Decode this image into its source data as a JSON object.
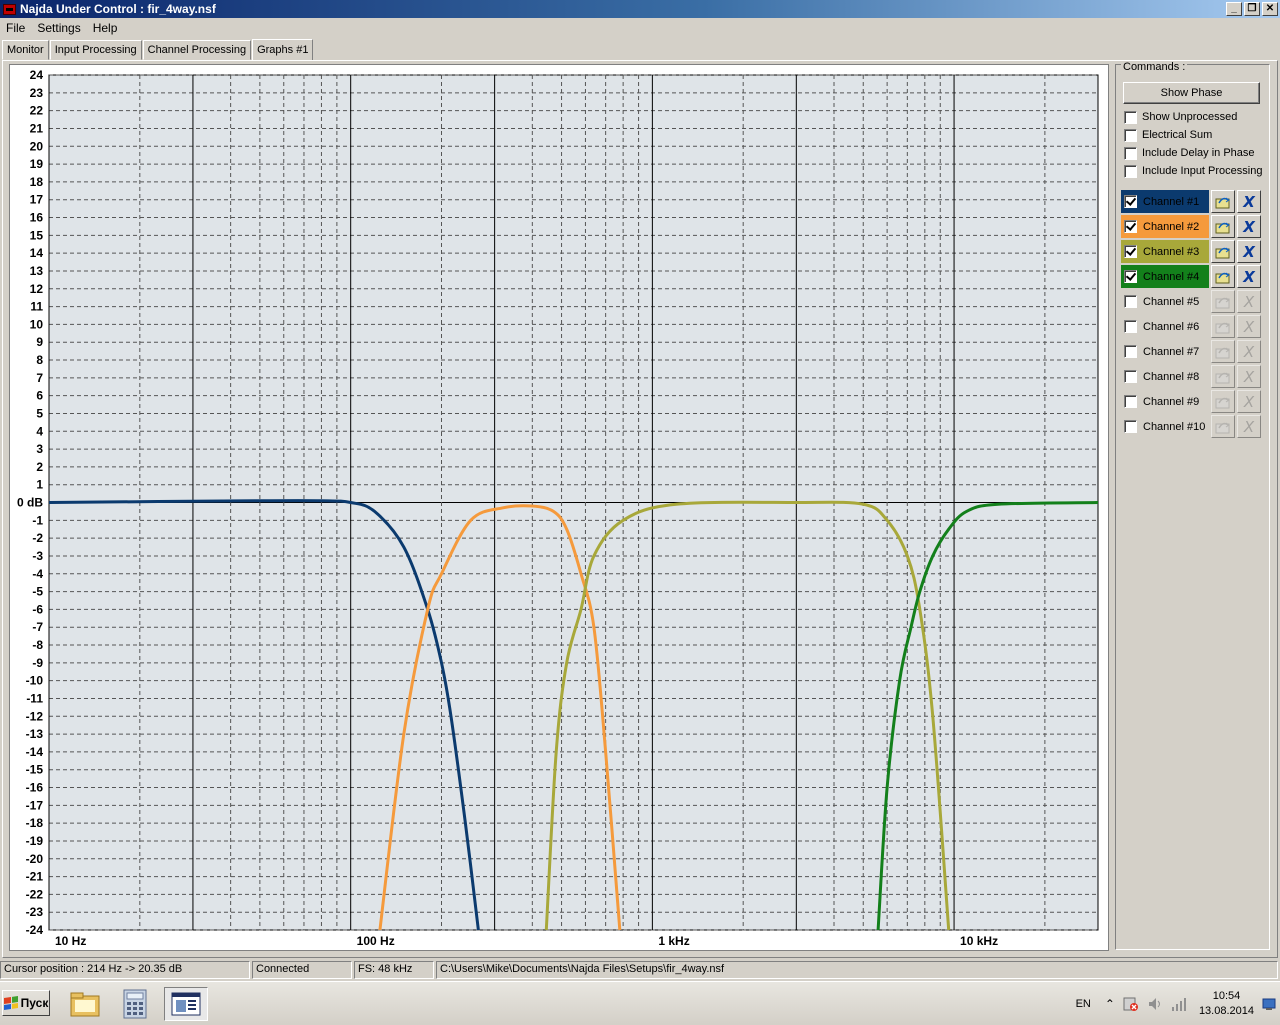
{
  "window": {
    "title": "Najda Under Control : fir_4way.nsf",
    "buttons": [
      "_",
      "❐",
      "✕"
    ]
  },
  "menu": [
    "File",
    "Settings",
    "Help"
  ],
  "tabs": [
    "Monitor",
    "Input Processing",
    "Channel Processing",
    "Graphs #1"
  ],
  "active_tab": 3,
  "commands": {
    "title": "Commands :",
    "show_phase": "Show Phase",
    "options": [
      {
        "label": "Show Unprocessed",
        "checked": false
      },
      {
        "label": "Electrical Sum",
        "checked": false
      },
      {
        "label": "Include Delay in Phase",
        "checked": false
      },
      {
        "label": "Include Input Processing",
        "checked": false
      }
    ],
    "channels": [
      {
        "label": "Channel #1",
        "checked": true,
        "color": "#0b3a6e"
      },
      {
        "label": "Channel #2",
        "checked": true,
        "color": "#f59a3c"
      },
      {
        "label": "Channel #3",
        "checked": true,
        "color": "#a8a83a"
      },
      {
        "label": "Channel #4",
        "checked": true,
        "color": "#13801b"
      },
      {
        "label": "Channel #5",
        "checked": false,
        "color": ""
      },
      {
        "label": "Channel #6",
        "checked": false,
        "color": ""
      },
      {
        "label": "Channel #7",
        "checked": false,
        "color": ""
      },
      {
        "label": "Channel #8",
        "checked": false,
        "color": ""
      },
      {
        "label": "Channel #9",
        "checked": false,
        "color": ""
      },
      {
        "label": "Channel #10",
        "checked": false,
        "color": ""
      }
    ],
    "channel_button_icons": [
      "folder-open-icon",
      "clear-icon"
    ]
  },
  "chart_data": {
    "type": "line",
    "x_scale": "log",
    "xlim": [
      10,
      30000
    ],
    "ylim": [
      -24,
      24
    ],
    "x_tick_labels": [
      {
        "value": 10,
        "label": "10 Hz"
      },
      {
        "value": 100,
        "label": "100 Hz"
      },
      {
        "value": 1000,
        "label": "1 kHz"
      },
      {
        "value": 10000,
        "label": "10 kHz"
      }
    ],
    "y_tick_labels": [
      "24",
      "23",
      "22",
      "21",
      "20",
      "19",
      "18",
      "17",
      "16",
      "15",
      "14",
      "13",
      "12",
      "11",
      "10",
      "9",
      "8",
      "7",
      "6",
      "5",
      "4",
      "3",
      "2",
      "1",
      "0 dB",
      "-1",
      "-2",
      "-3",
      "-4",
      "-5",
      "-6",
      "-7",
      "-8",
      "-9",
      "-10",
      "-11",
      "-12",
      "-13",
      "-14",
      "-15",
      "-16",
      "-17",
      "-18",
      "-19",
      "-20",
      "-21",
      "-22",
      "-23",
      "-24"
    ],
    "grid": true,
    "series": [
      {
        "name": "Channel #1",
        "color": "#0b3a6e",
        "x": [
          10,
          50,
          80,
          100,
          120,
          150,
          180,
          200,
          215,
          240,
          265
        ],
        "y": [
          0,
          0.1,
          0.1,
          0,
          -0.5,
          -2.5,
          -6,
          -9,
          -12,
          -18,
          -24
        ]
      },
      {
        "name": "Channel #2",
        "color": "#f59a3c",
        "x": [
          125,
          150,
          180,
          200,
          250,
          320,
          400,
          470,
          520,
          580,
          640,
          700,
          780
        ],
        "y": [
          -24,
          -13,
          -6,
          -4,
          -1,
          -0.3,
          -0.2,
          -0.5,
          -1.5,
          -4,
          -7,
          -14,
          -24
        ]
      },
      {
        "name": "Channel #3",
        "color": "#a8a83a",
        "x": [
          445,
          480,
          520,
          580,
          640,
          800,
          1200,
          3000,
          5000,
          6000,
          7000,
          7700,
          8500,
          9600
        ],
        "y": [
          -24,
          -14,
          -9,
          -6,
          -3,
          -1,
          -0.1,
          0,
          -0.1,
          -1,
          -3,
          -6,
          -12,
          -24
        ]
      },
      {
        "name": "Channel #4",
        "color": "#13801b",
        "x": [
          5600,
          6000,
          6600,
          7200,
          7700,
          8500,
          9600,
          11000,
          14000,
          30000
        ],
        "y": [
          -24,
          -16,
          -10,
          -7,
          -5,
          -3,
          -1.5,
          -0.5,
          -0.1,
          0
        ]
      }
    ]
  },
  "status": {
    "cursor": "Cursor position : 214 Hz -> 20.35 dB",
    "connection": "Connected",
    "fs": "FS: 48 kHz",
    "path": "C:\\Users\\Mike\\Documents\\Najda Files\\Setups\\fir_4way.nsf"
  },
  "taskbar": {
    "start": "Пуск",
    "apps": [
      "file-explorer-icon",
      "calculator-icon",
      "najda-app-icon"
    ],
    "lang": "EN",
    "time": "10:54",
    "date": "13.08.2014"
  }
}
